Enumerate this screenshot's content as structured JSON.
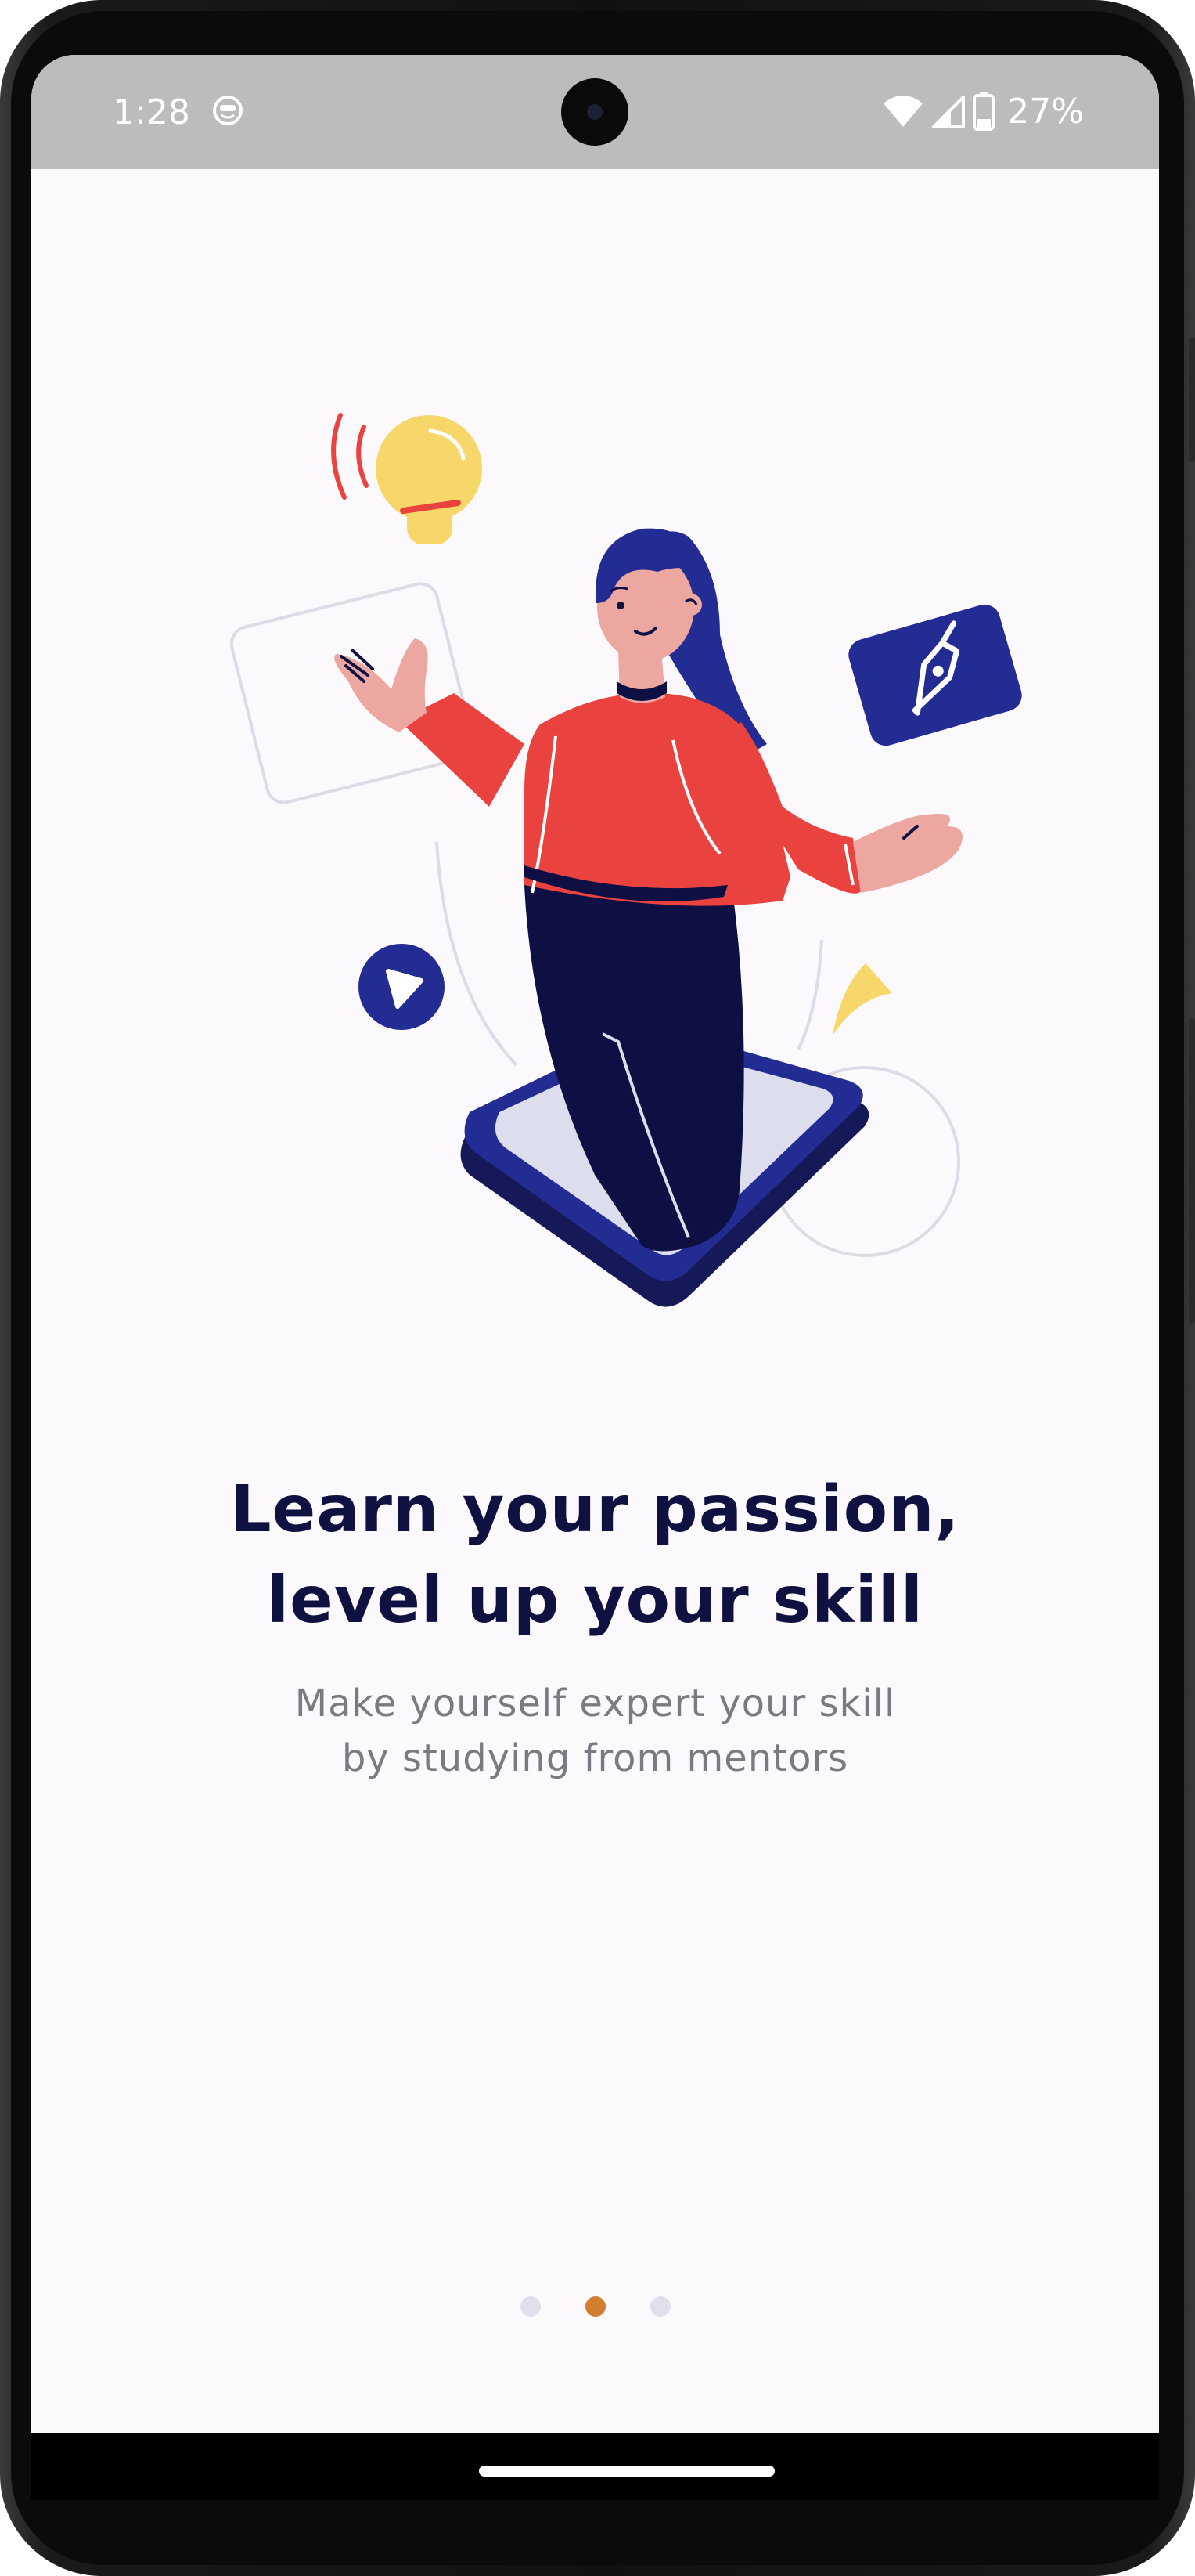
{
  "status_bar": {
    "time": "1:28",
    "battery": "27%",
    "icons": [
      "face-icon",
      "wifi-icon",
      "cell-signal-icon",
      "battery-icon"
    ]
  },
  "onboarding": {
    "headline_line1": "Learn your passion,",
    "headline_line2": "level up your skill",
    "subtitle_line1": "Make yourself expert your skill",
    "subtitle_line2": "by studying from mentors",
    "illustration_icon": "woman-emerging-from-phone-illustration",
    "page_indicator": {
      "total": 3,
      "active_index": 1
    }
  },
  "colors": {
    "background": "#fcf9fc",
    "headline": "#0f1141",
    "subtitle": "#7a7a82",
    "accent_dot": "#d27e30",
    "inactive_dot": "#e0dfec",
    "status_bar": "#bdbbbe",
    "navy": "#232c93",
    "red": "#ea423f",
    "yellow": "#f7d76a"
  }
}
